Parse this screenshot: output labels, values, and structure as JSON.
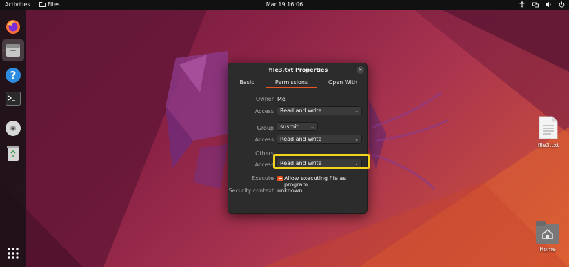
{
  "topbar": {
    "activities": "Activities",
    "app_name": "Files",
    "clock": "Mar 19  16:06"
  },
  "dock": {
    "items": [
      {
        "name": "Firefox",
        "icon": "firefox-icon"
      },
      {
        "name": "Files",
        "icon": "files-icon",
        "active": true
      },
      {
        "name": "Help",
        "icon": "help-icon"
      },
      {
        "name": "Terminal",
        "icon": "terminal-icon"
      },
      {
        "name": "DVD",
        "icon": "disc-icon"
      },
      {
        "name": "Trash",
        "icon": "trash-icon"
      },
      {
        "name": "Show Applications",
        "icon": "app-grid-icon"
      }
    ]
  },
  "desktop": {
    "file_label": "file3.txt",
    "home_label": "Home"
  },
  "dialog": {
    "title": "file3.txt Properties",
    "close": "×",
    "tabs": [
      "Basic",
      "Permissions",
      "Open With"
    ],
    "active_tab": "Permissions",
    "owner_label": "Owner",
    "owner_value": "Me",
    "owner_access_label": "Access",
    "owner_access_value": "Read and write",
    "group_label": "Group",
    "group_value": "susmit",
    "group_access_label": "Access",
    "group_access_value": "Read and write",
    "others_label": "Others",
    "others_access_label": "Access",
    "others_access_value": "Read and write",
    "execute_label": "Execute",
    "execute_checkbox_label": "Allow executing file as program",
    "execute_checked": "indeterminate",
    "security_label": "Security context",
    "security_value": "unknown",
    "chevron": "⌄"
  },
  "colors": {
    "accent": "#e95420",
    "highlight": "#f2d21b",
    "dialog_bg": "#2c2c2c"
  }
}
